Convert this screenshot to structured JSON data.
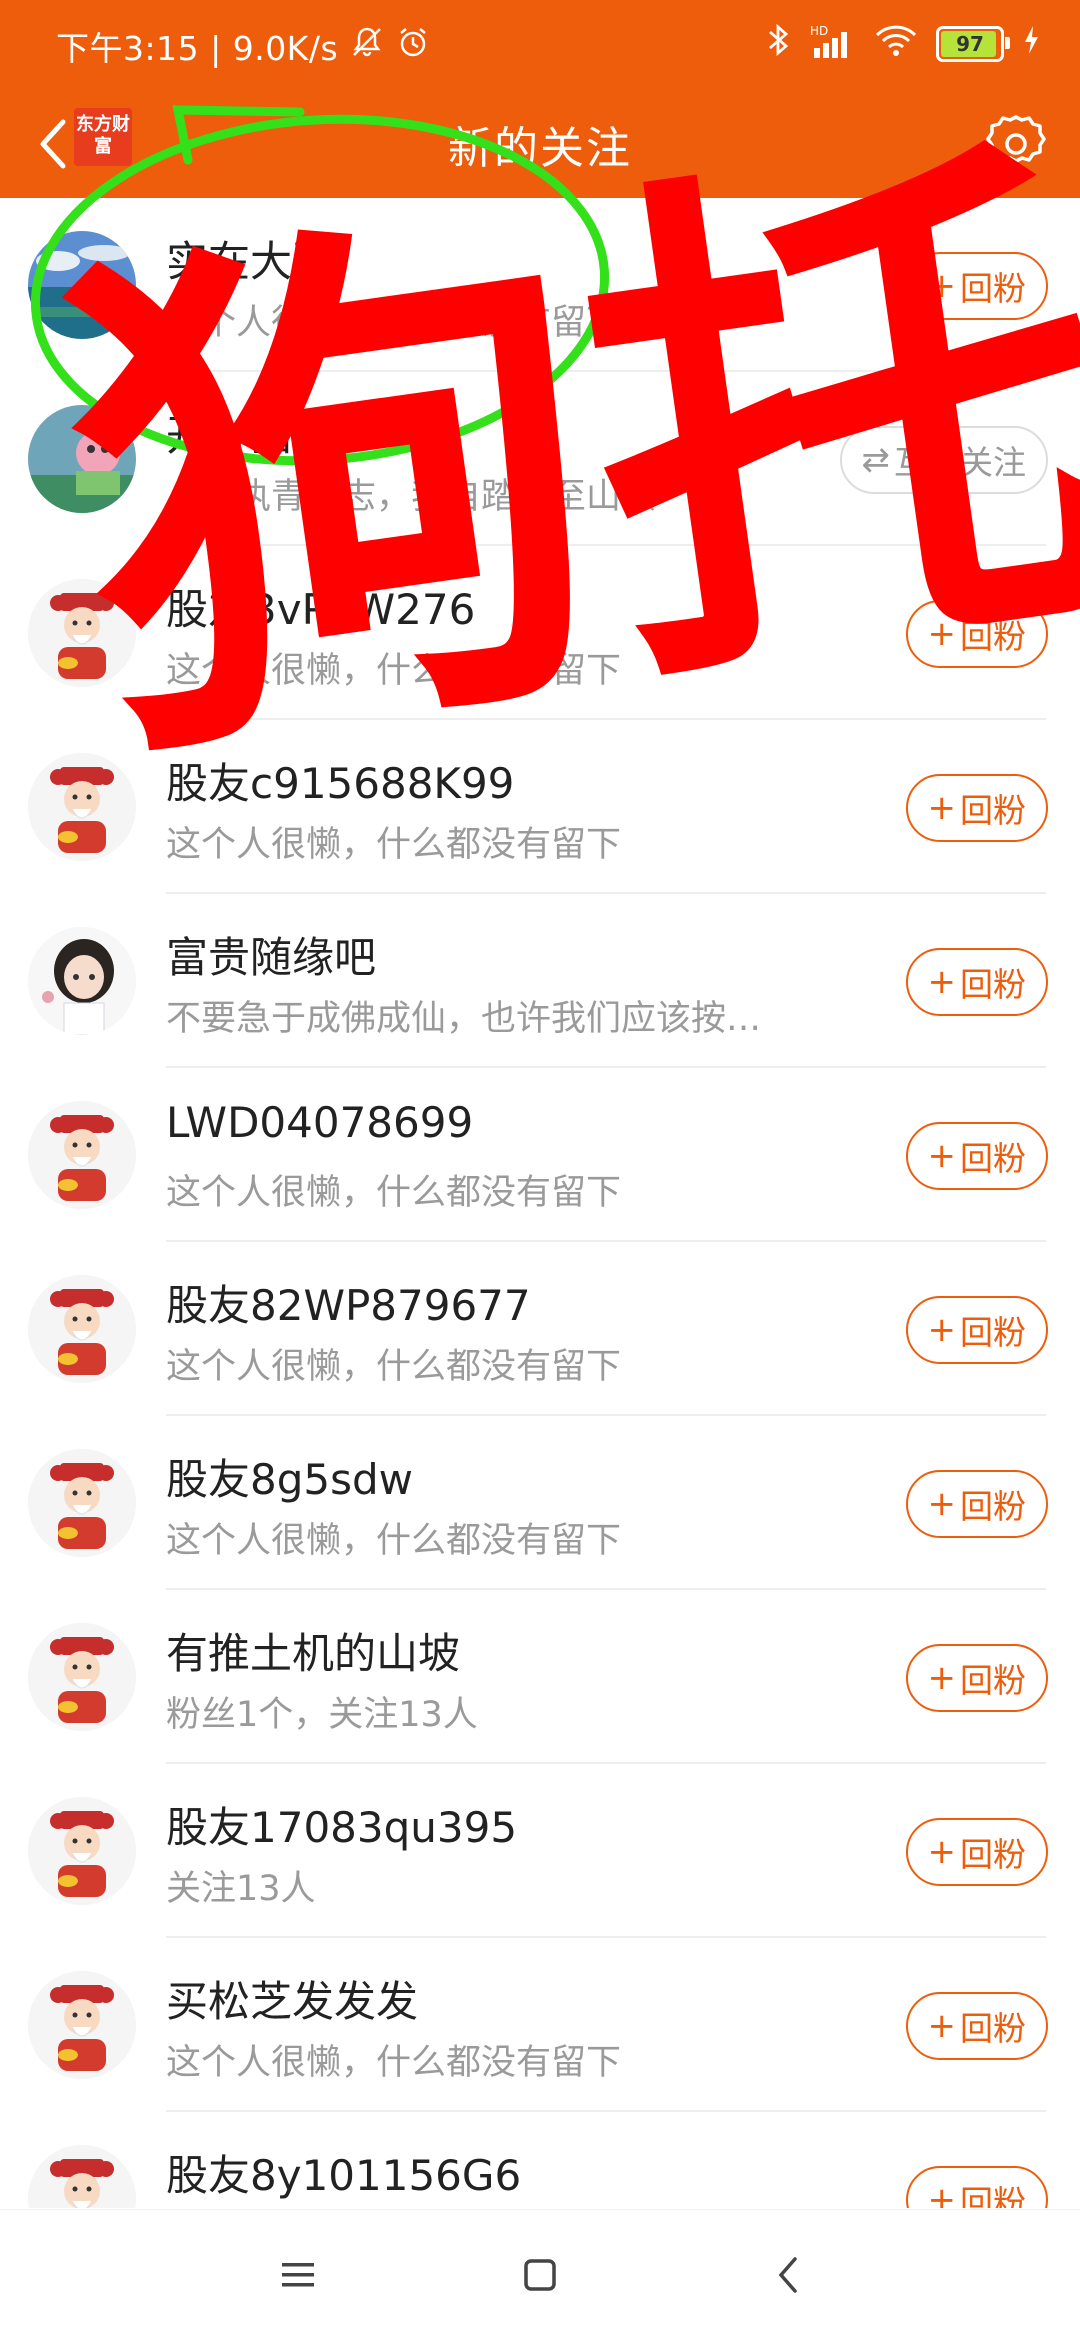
{
  "status_bar": {
    "time_speed": "下午3:15 | 9.0K/s",
    "network": "HD",
    "battery": "97"
  },
  "header": {
    "app_logo": "东方财富",
    "title": "新的关注"
  },
  "follow_label": "回粉",
  "mutual_label": "互相关注",
  "items": [
    {
      "name": "实在大哥",
      "desc": "这个人很懒，什么都没有留下",
      "button": "回粉",
      "avatar": "landscape"
    },
    {
      "name": "开心猫",
      "desc": "人人执青云志，我自踏雪至山巅",
      "button": "互相关注",
      "avatar": "cartoon"
    },
    {
      "name": "股友3vP2W276",
      "desc": "这个人很懒，什么都没有留下",
      "button": "回粉",
      "avatar": "god-of-wealth"
    },
    {
      "name": "股友c915688K99",
      "desc": "这个人很懒，什么都没有留下",
      "button": "回粉",
      "avatar": "god-of-wealth"
    },
    {
      "name": "富贵随缘吧",
      "desc": "不要急于成佛成仙，也许我们应该按…",
      "button": "回粉",
      "avatar": "girl"
    },
    {
      "name": "LWD04078699",
      "desc": "这个人很懒，什么都没有留下",
      "button": "回粉",
      "avatar": "god-of-wealth"
    },
    {
      "name": "股友82WP879677",
      "desc": "这个人很懒，什么都没有留下",
      "button": "回粉",
      "avatar": "god-of-wealth"
    },
    {
      "name": "股友8g5sdw",
      "desc": "这个人很懒，什么都没有留下",
      "button": "回粉",
      "avatar": "god-of-wealth"
    },
    {
      "name": "有推土机的山坡",
      "desc": "粉丝1个，关注13人",
      "button": "回粉",
      "avatar": "god-of-wealth"
    },
    {
      "name": "股友17083qu395",
      "desc": "关注13人",
      "button": "回粉",
      "avatar": "god-of-wealth"
    },
    {
      "name": "买松芝发发发",
      "desc": "这个人很懒，什么都没有留下",
      "button": "回粉",
      "avatar": "god-of-wealth"
    },
    {
      "name": "股友8y101156G6",
      "desc": "",
      "button": "回粉",
      "avatar": "god-of-wealth"
    }
  ],
  "annotation": {
    "text": "狗托",
    "text_color": "#ff0000",
    "circle_color": "#33e01a"
  },
  "colors": {
    "brand": "#ed5d0c",
    "follow": "#ed5d0c",
    "mutual": "#9a9a9a"
  }
}
